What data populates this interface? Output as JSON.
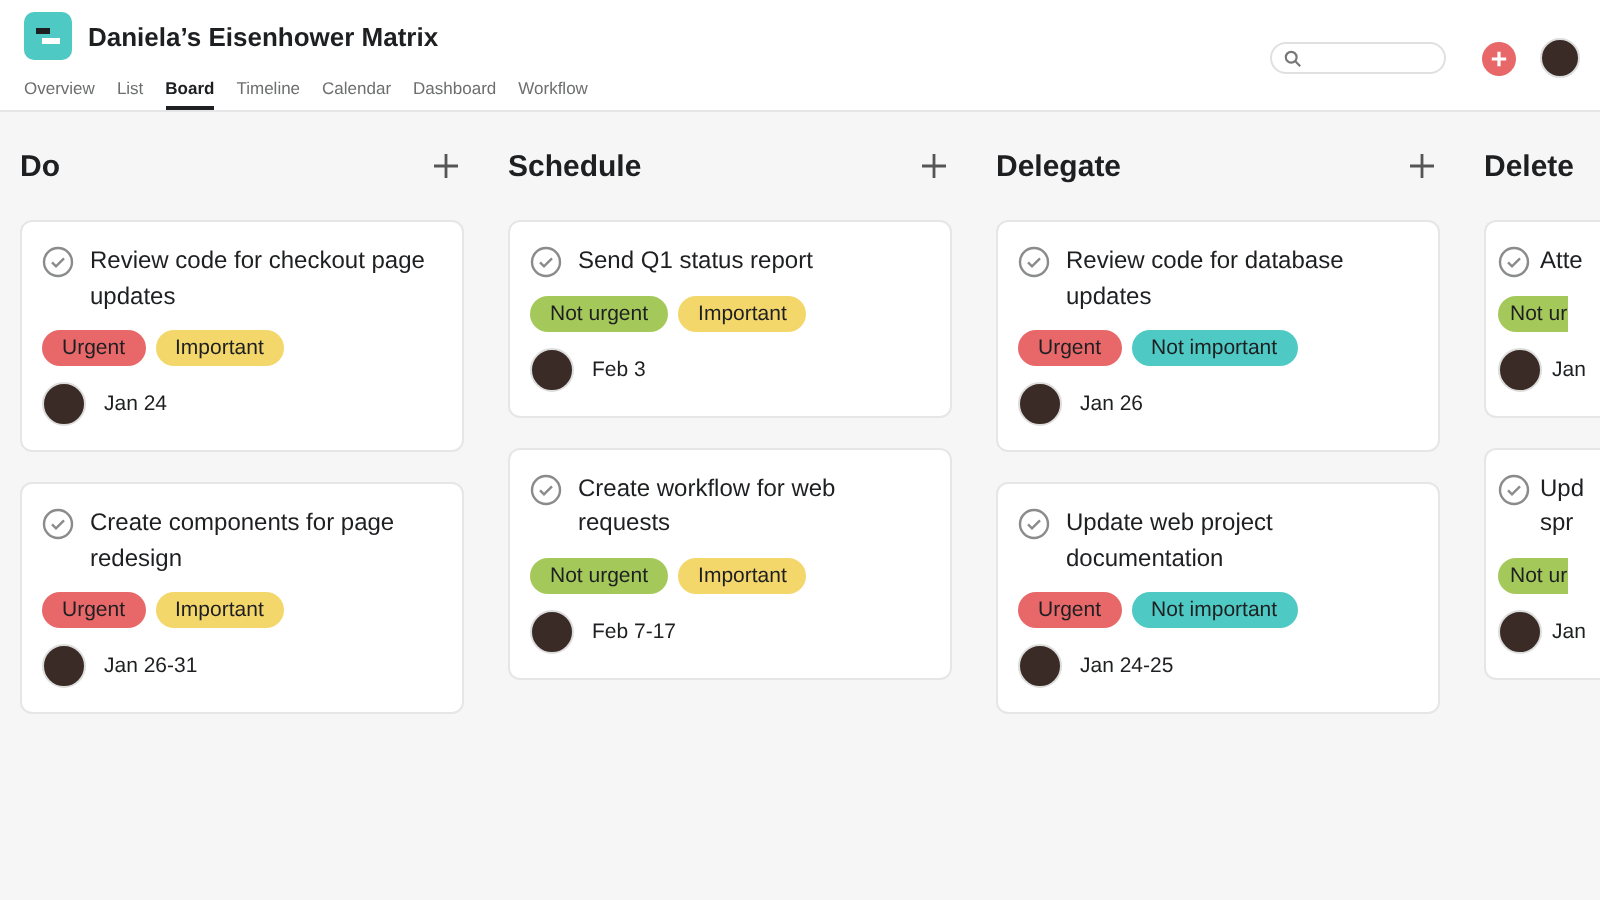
{
  "project": {
    "title": "Daniela’s Eisenhower Matrix"
  },
  "tabs": [
    {
      "label": "Overview",
      "selected": false
    },
    {
      "label": "List",
      "selected": false
    },
    {
      "label": "Board",
      "selected": true
    },
    {
      "label": "Timeline",
      "selected": false
    },
    {
      "label": "Calendar",
      "selected": false
    },
    {
      "label": "Dashboard",
      "selected": false
    },
    {
      "label": "Workflow",
      "selected": false
    }
  ],
  "columns": [
    {
      "title": "Do",
      "partial": false,
      "cards": [
        {
          "title": "Review code for checkout page updates",
          "tags": [
            {
              "label": "Urgent",
              "color": "#e8686a"
            },
            {
              "label": "Important",
              "color": "#f4d76b"
            }
          ],
          "date": "Jan 24"
        },
        {
          "title": "Create components for page redesign",
          "tags": [
            {
              "label": "Urgent",
              "color": "#e8686a"
            },
            {
              "label": "Important",
              "color": "#f4d76b"
            }
          ],
          "date": "Jan 26-31"
        }
      ]
    },
    {
      "title": "Schedule",
      "partial": false,
      "cards": [
        {
          "title": "Send Q1 status report",
          "tags": [
            {
              "label": "Not urgent",
              "color": "#a4c95a"
            },
            {
              "label": "Important",
              "color": "#f4d76b"
            }
          ],
          "date": "Feb 3"
        },
        {
          "title": "Create workflow for web requests",
          "tags": [
            {
              "label": "Not urgent",
              "color": "#a4c95a"
            },
            {
              "label": "Important",
              "color": "#f4d76b"
            }
          ],
          "date": "Feb 7-17"
        }
      ]
    },
    {
      "title": "Delegate",
      "partial": false,
      "cards": [
        {
          "title": "Review code for database updates",
          "tags": [
            {
              "label": "Urgent",
              "color": "#e8686a"
            },
            {
              "label": "Not important",
              "color": "#4ec9c4"
            }
          ],
          "date": "Jan 26"
        },
        {
          "title": "Update web project documentation",
          "tags": [
            {
              "label": "Urgent",
              "color": "#e8686a"
            },
            {
              "label": "Not important",
              "color": "#4ec9c4"
            }
          ],
          "date": "Jan 24-25"
        }
      ]
    },
    {
      "title": "Delete",
      "partial": true,
      "cards": [
        {
          "title": "Atte",
          "tags": [
            {
              "label": "Not ur",
              "color": "#a4c95a"
            }
          ],
          "date": "Jan"
        },
        {
          "title": "Upd spr",
          "tags": [
            {
              "label": "Not ur",
              "color": "#a4c95a"
            }
          ],
          "date": "Jan"
        }
      ]
    }
  ]
}
